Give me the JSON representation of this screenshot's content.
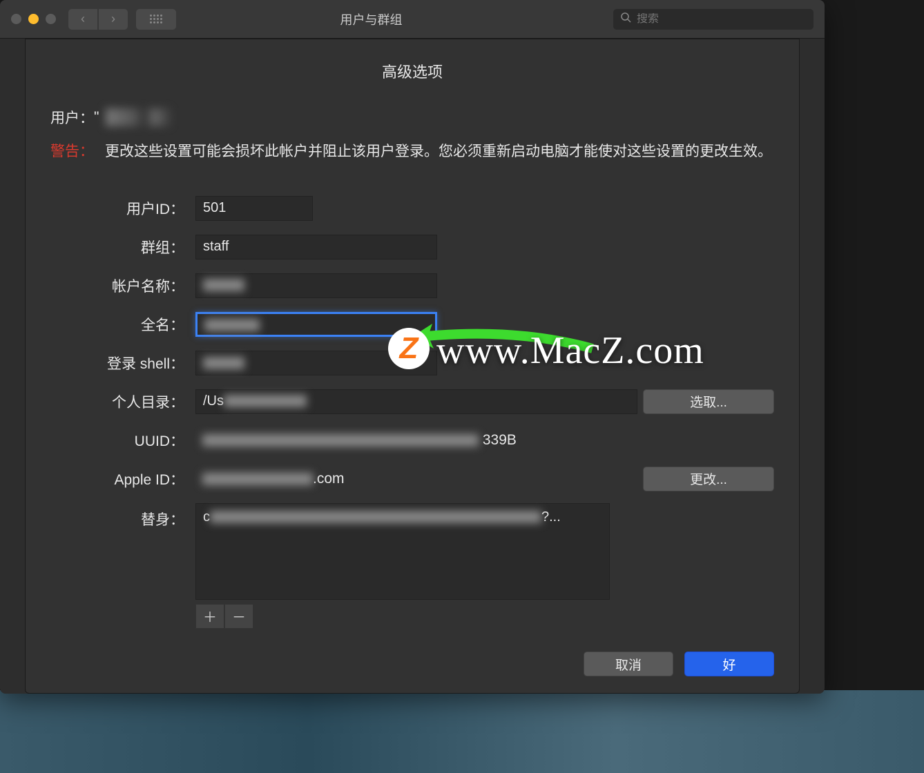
{
  "titlebar": {
    "window_title": "用户与群组",
    "search_placeholder": "搜索"
  },
  "dialog": {
    "title": "高级选项",
    "user_label": "用户：",
    "user_quote": "\"",
    "warning_label": "警告：",
    "warning_text": "更改这些设置可能会损坏此帐户并阻止该用户登录。您必须重新启动电脑才能使对这些设置的更改生效。"
  },
  "fields": {
    "user_id": {
      "label": "用户ID：",
      "value": "501"
    },
    "group": {
      "label": "群组：",
      "value": "staff"
    },
    "account_name": {
      "label": "帐户名称：",
      "value": ""
    },
    "full_name": {
      "label": "全名：",
      "value": ""
    },
    "login_shell": {
      "label": "登录 shell：",
      "value": ""
    },
    "home_dir": {
      "label": "个人目录：",
      "value_prefix": "/Us",
      "button": "选取..."
    },
    "uuid": {
      "label": "UUID：",
      "value_suffix": "339B"
    },
    "apple_id": {
      "label": "Apple ID：",
      "value_suffix": ".com",
      "button": "更改..."
    },
    "aliases": {
      "label": "替身：",
      "value_prefix": "c",
      "value_suffix": "?..."
    }
  },
  "buttons": {
    "plus": "＋",
    "minus": "－",
    "cancel": "取消",
    "ok": "好"
  },
  "watermark": {
    "logo": "Z",
    "text": "www.MacZ.com"
  }
}
